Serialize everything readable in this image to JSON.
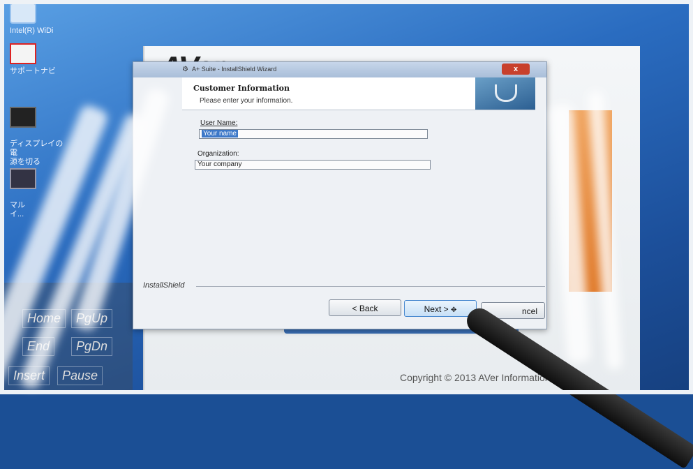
{
  "desktop": {
    "icons": [
      {
        "label": "Intel(R) WiDi",
        "icon": "intel-widi-icon"
      },
      {
        "label": "サポートナビ",
        "icon": "support-navi-icon"
      },
      {
        "label": "ディスプレイの電\n源を切る",
        "icon": "display-off-icon"
      },
      {
        "label": "マル\nイ...",
        "icon": "media-icon"
      }
    ]
  },
  "app": {
    "logo": "AVer",
    "copyright": "Copyright © 2013 AVer Information Inc. All"
  },
  "keyboard": {
    "keys": [
      "Home",
      "PgUp",
      "End",
      "PgDn",
      "Insert",
      "Pause"
    ]
  },
  "dialog": {
    "title": "A+ Suite - InstallShield Wizard",
    "close_label": "x",
    "banner_title": "Customer Information",
    "banner_subtitle": "Please enter your information.",
    "user_name_label": "User Name:",
    "user_name_value": "Your name",
    "organization_label": "Organization:",
    "organization_value": "Your company",
    "brand_label": "InstallShield",
    "back_label": "< Back",
    "next_label": "Next >",
    "cancel_label": "ncel"
  },
  "colors": {
    "desktop_blue": "#1b4f95",
    "selection_blue": "#3c78c8",
    "close_red": "#c8402c",
    "app_orange": "#e07a2a"
  }
}
